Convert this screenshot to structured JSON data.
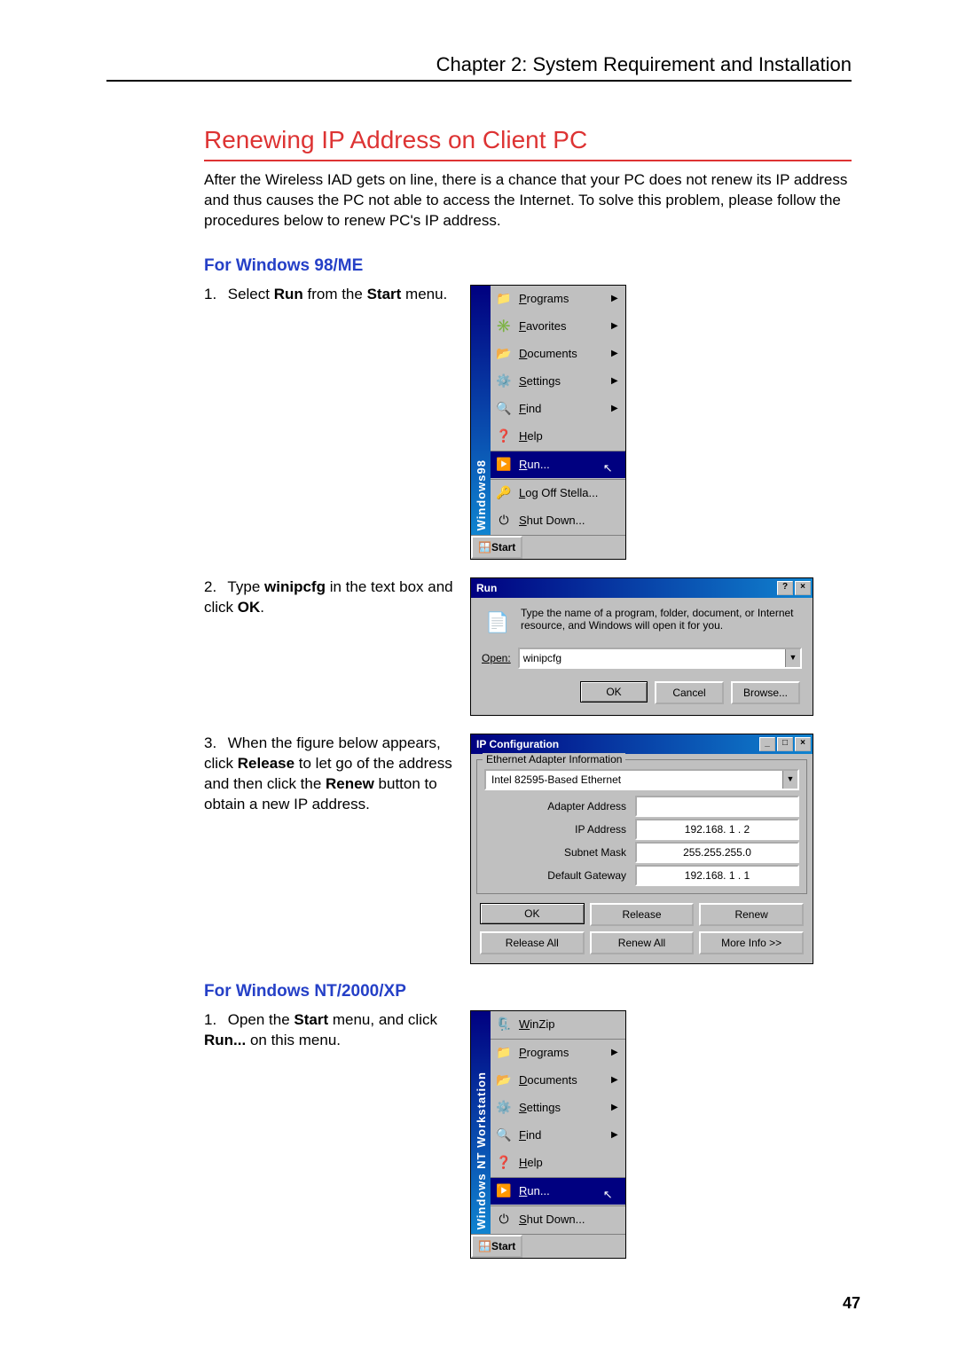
{
  "chapter": "Chapter 2: System Requirement and Installation",
  "title": "Renewing IP Address on Client PC",
  "intro": "After the Wireless IAD gets on line, there is a chance that your PC does not renew its IP address and thus causes the PC not able to access the Internet. To solve this problem, please follow the procedures below to renew PC's IP address.",
  "section1": "For Windows 98/ME",
  "step1_prefix": "Select ",
  "step1_b1": "Run",
  "step1_mid": " from the ",
  "step1_b2": "Start",
  "step1_suffix": " menu.",
  "step2_prefix": "Type ",
  "step2_b1": "winipcfg",
  "step2_mid": " in the text box and click ",
  "step2_b2": "OK",
  "step2_suffix": ".",
  "step3_prefix": "When the figure below appears, click ",
  "step3_b1": "Release",
  "step3_mid": " to let go of the address and then click the ",
  "step3_b2": "Renew",
  "step3_suffix": " button to obtain a new IP address.",
  "section2": "For Windows NT/2000/XP",
  "step4_prefix": "Open the ",
  "step4_b1": "Start",
  "step4_mid": " menu, and click ",
  "step4_b2": "Run...",
  "step4_suffix": " on this menu.",
  "page_number": "47",
  "start98": {
    "side": "Windows98",
    "items": [
      {
        "label": "Programs",
        "arrow": true
      },
      {
        "label": "Favorites",
        "arrow": true
      },
      {
        "label": "Documents",
        "arrow": true
      },
      {
        "label": "Settings",
        "arrow": true
      },
      {
        "label": "Find",
        "arrow": true
      },
      {
        "label": "Help",
        "arrow": false
      },
      {
        "label": "Run...",
        "arrow": false,
        "highlight": true,
        "sep": true
      },
      {
        "label": "Log Off Stella...",
        "arrow": false,
        "sep": true
      },
      {
        "label": "Shut Down...",
        "arrow": false
      }
    ],
    "start": "Start"
  },
  "run": {
    "title": "Run",
    "help": "?",
    "close": "×",
    "msg": "Type the name of a program, folder, document, or Internet resource, and Windows will open it for you.",
    "open_label": "Open:",
    "value": "winipcfg",
    "ok": "OK",
    "cancel": "Cancel",
    "browse": "Browse..."
  },
  "ipcfg": {
    "title": "IP Configuration",
    "min": "_",
    "max": "□",
    "close": "×",
    "legend": "Ethernet Adapter Information",
    "adapter": "Intel 82595-Based Ethernet",
    "rows": {
      "adapter_addr_label": "Adapter Address",
      "adapter_addr": "",
      "ip_label": "IP Address",
      "ip": "192.168. 1 . 2",
      "mask_label": "Subnet Mask",
      "mask": "255.255.255.0",
      "gw_label": "Default Gateway",
      "gw": "192.168. 1 . 1"
    },
    "btn_ok": "OK",
    "btn_release": "Release",
    "btn_renew": "Renew",
    "btn_release_all": "Release All",
    "btn_renew_all": "Renew All",
    "btn_more": "More Info >>"
  },
  "startnt": {
    "side": "Windows NT Workstation",
    "items": [
      {
        "label": "WinZip",
        "arrow": false
      },
      {
        "label": "Programs",
        "arrow": true,
        "sep": true
      },
      {
        "label": "Documents",
        "arrow": true
      },
      {
        "label": "Settings",
        "arrow": true
      },
      {
        "label": "Find",
        "arrow": true
      },
      {
        "label": "Help",
        "arrow": false
      },
      {
        "label": "Run...",
        "arrow": false,
        "highlight": true,
        "sep": true
      },
      {
        "label": "Shut Down...",
        "arrow": false,
        "sep": true
      }
    ],
    "start": "Start"
  }
}
